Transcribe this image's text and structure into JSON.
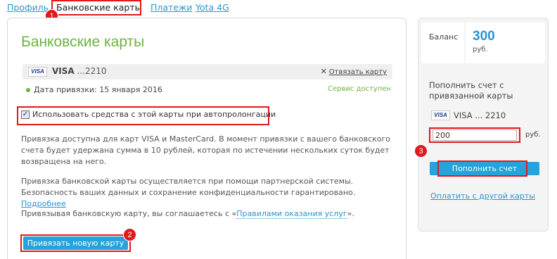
{
  "tabs": [
    {
      "label": "Профиль",
      "active": false
    },
    {
      "label": "Банковские карты",
      "active": true
    },
    {
      "label": "Платежи",
      "active": false
    },
    {
      "label": "Yota 4G",
      "active": false
    }
  ],
  "markers": [
    "1",
    "2",
    "3"
  ],
  "main": {
    "title": "Банковские карты",
    "card": {
      "brand": "VISA",
      "number_prefix": "VISA",
      "number_suffix": "...2210",
      "unlink_label": "Отвязать карту"
    },
    "bind_date": "Дата привязки: 15 января 2016",
    "service_status": "Сервис доступен",
    "auto_renew": {
      "checked": true,
      "label": "Использовать средства с этой карты при автопролонгации"
    },
    "paragraph1": "Привязка доступна для карт VISA и MasterCard. В момент привязки с вашего банковского счета будет удержана сумма в 10 рублей, которая по истечении нескольких суток будет возвращена на него.",
    "paragraph2_text": "Привязка банковской карты осуществляется при помощи партнерской системы. Безопасность ваших данных и сохранение конфиденциальности гарантировано.",
    "paragraph2_link": "Подробнее",
    "paragraph3_text": "Привязывая банковскую карту, вы соглашаетесь с «",
    "paragraph3_link": "Правилами оказания услуг",
    "paragraph3_end": "».",
    "bind_button": "Привязать новую карту"
  },
  "side": {
    "balance_label": "Баланс",
    "balance_amount": "300",
    "balance_unit": "руб.",
    "topup_title": "Пополнить счет с привязанной карты",
    "card_brand": "VISA",
    "card_number": "VISA ... 2210",
    "amount_value": "200",
    "amount_unit": "руб.",
    "topup_button": "Пополнить счет",
    "other_card_link": "Оплатить с другой карты"
  },
  "colors": {
    "accent_blue": "#26a3dc",
    "link_blue": "#2b94cf",
    "title_green": "#6db33f",
    "highlight_red": "#e0191c"
  }
}
